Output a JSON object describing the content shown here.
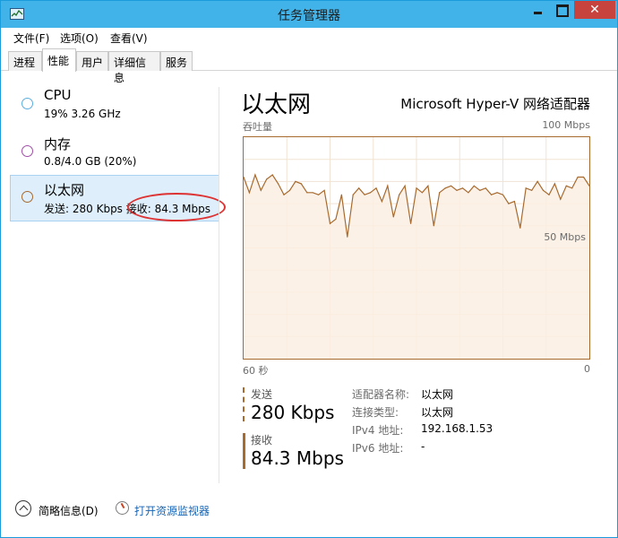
{
  "window": {
    "title": "任务管理器"
  },
  "menu": [
    "文件(F)",
    "选项(O)",
    "查看(V)"
  ],
  "tabs": [
    "进程",
    "性能",
    "用户",
    "详细信息",
    "服务"
  ],
  "active_tab": "性能",
  "resources": [
    {
      "name": "CPU",
      "sub": "19% 3.26 GHz",
      "circle_color": "#5aaee0"
    },
    {
      "name": "内存",
      "sub": "0.8/4.0 GB (20%)",
      "circle_color": "#a14ea8"
    },
    {
      "name": "以太网",
      "sub": "发送: 280 Kbps 接收: 84.3 Mbps",
      "circle_color": "#a76a2f"
    }
  ],
  "ethernet": {
    "title": "以太网",
    "adapter": "Microsoft Hyper-V 网络适配器",
    "throughput_label": "吞吐量",
    "max_label": "100 Mbps",
    "mid_label": "50 Mbps",
    "axis_left": "60 秒",
    "axis_right": "0",
    "send_label": "发送",
    "send_value": "280 Kbps",
    "recv_label": "接收",
    "recv_value": "84.3 Mbps",
    "details": [
      {
        "label": "适配器名称:",
        "value": "以太网"
      },
      {
        "label": "连接类型:",
        "value": "以太网"
      },
      {
        "label": "IPv4 地址:",
        "value": "192.168.1.53"
      },
      {
        "label": "IPv6 地址:",
        "value": "-"
      }
    ]
  },
  "chart_data": {
    "type": "area",
    "x": [
      60,
      59,
      58,
      57,
      56,
      55,
      54,
      53,
      52,
      51,
      50,
      49,
      48,
      47,
      46,
      45,
      44,
      43,
      42,
      41,
      40,
      39,
      38,
      37,
      36,
      35,
      34,
      33,
      32,
      31,
      30,
      29,
      28,
      27,
      26,
      25,
      24,
      23,
      22,
      21,
      20,
      19,
      18,
      17,
      16,
      15,
      14,
      13,
      12,
      11,
      10,
      9,
      8,
      7,
      6,
      5,
      4,
      3,
      2,
      1,
      0
    ],
    "values": [
      82,
      75,
      83,
      76,
      81,
      83,
      79,
      74,
      76,
      80,
      79,
      75,
      75,
      74,
      76,
      61,
      63,
      74,
      55,
      74,
      77,
      74,
      75,
      77,
      71,
      78,
      64,
      74,
      78,
      61,
      77,
      75,
      78,
      60,
      75,
      77,
      78,
      76,
      77,
      75,
      78,
      76,
      77,
      74,
      75,
      74,
      70,
      71,
      59,
      77,
      76,
      80,
      76,
      74,
      79,
      72,
      78,
      77,
      82,
      82,
      78
    ],
    "series": [
      {
        "name": "以太网",
        "values": [
          82,
          75,
          83,
          76,
          81,
          83,
          79,
          74,
          76,
          80,
          79,
          75,
          75,
          74,
          76,
          61,
          63,
          74,
          55,
          74,
          77,
          74,
          75,
          77,
          71,
          78,
          64,
          74,
          78,
          61,
          77,
          75,
          78,
          60,
          75,
          77,
          78,
          76,
          77,
          75,
          78,
          76,
          77,
          74,
          75,
          74,
          70,
          71,
          59,
          77,
          76,
          80,
          76,
          74,
          79,
          72,
          78,
          77,
          82,
          82,
          78
        ]
      }
    ],
    "xlabel": "60 秒",
    "ylabel": "吞吐量",
    "ylim": [
      0,
      100
    ],
    "grid": true,
    "line_color": "#a76a2f",
    "fill_color": "#fbeee2"
  },
  "footer": {
    "brief": "简略信息(D)",
    "monitor": "打开资源监视器"
  }
}
